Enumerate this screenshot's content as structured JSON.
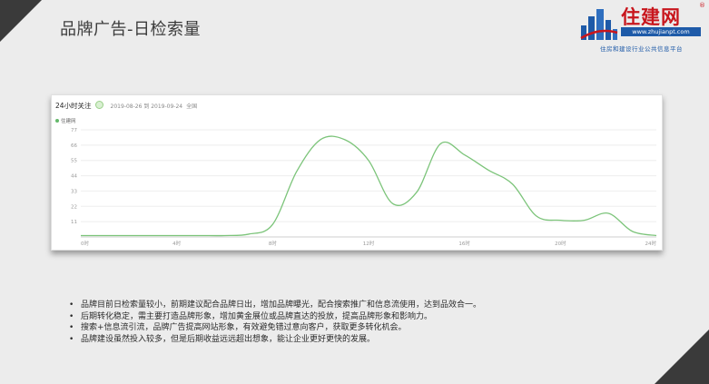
{
  "slide": {
    "title": "品牌广告-日检索量",
    "bullets": [
      "品牌目前日检索量较小，前期建议配合品牌日出，增加品牌曝光，配合搜索推广和信息流使用，达到品效合一。",
      "后期转化稳定，需主要打造品牌形象，增加黄金展位或品牌直达的投放，提高品牌形象和影响力。",
      "搜索+信息流引流，品牌广告提高网站形象，有效避免错过意向客户，获取更多转化机会。",
      "品牌建设虽然投入较多，但是后期收益远远超出想象，能让企业更好更快的发展。"
    ]
  },
  "logo": {
    "name": "住建网",
    "registered": "®",
    "url": "www.zhujianpt.com",
    "tagline": "住房和建设行业公共信息平台"
  },
  "card": {
    "header_title": "24小时关注",
    "date_range": "2019-08-26 到 2019-09-24",
    "all_label": "全国"
  },
  "colors": {
    "line": "#7cc47a",
    "accent_dark": "#3a3a3a",
    "logo_red": "#c8161d",
    "logo_blue": "#1e5aa8"
  },
  "chart_data": {
    "type": "line",
    "series": [
      {
        "name": "住建网",
        "x": [
          0,
          1,
          2,
          3,
          4,
          5,
          6,
          7,
          8,
          9,
          10,
          11,
          12,
          13,
          14,
          15,
          16,
          17,
          18,
          19,
          20,
          21,
          22,
          23,
          24
        ],
        "values": [
          1,
          1,
          1,
          1,
          1,
          1,
          1,
          2,
          9,
          47,
          70,
          70,
          55,
          24,
          32,
          67,
          59,
          48,
          38,
          15,
          12,
          12,
          17,
          4,
          1
        ]
      }
    ],
    "xticks": [
      0,
      4,
      8,
      12,
      16,
      20,
      24
    ],
    "xtick_labels": [
      "0时",
      "4时",
      "8时",
      "12时",
      "16时",
      "20时",
      "24时"
    ],
    "yticks": [
      11,
      22,
      33,
      44,
      55,
      66,
      77
    ],
    "ylim": [
      0,
      77
    ],
    "xlim": [
      0,
      24
    ],
    "grid": "horizontal",
    "legend_position": "top-left"
  }
}
